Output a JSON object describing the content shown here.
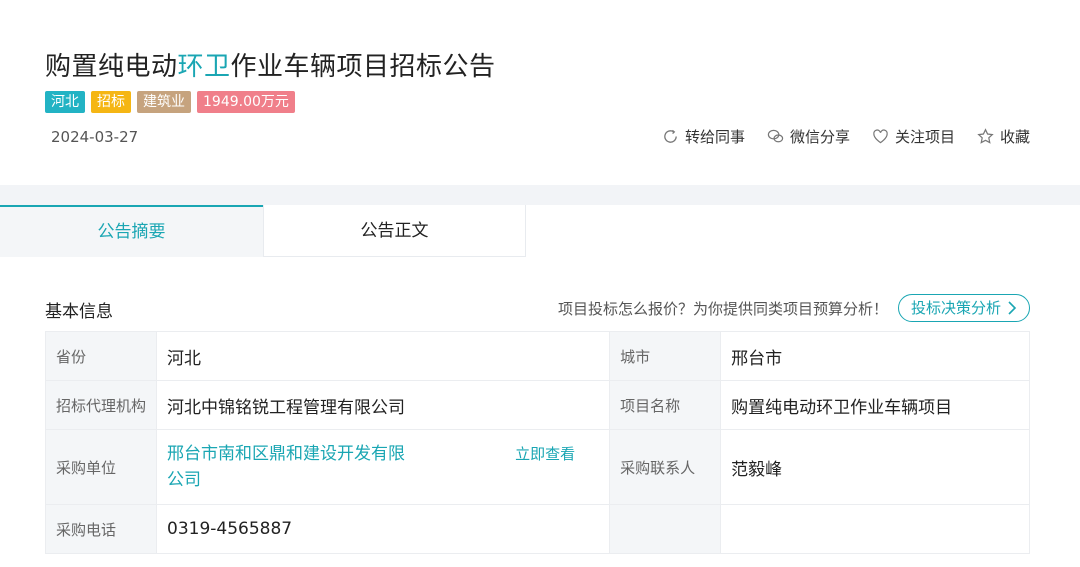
{
  "header": {
    "title_part1": "购置纯电动",
    "title_highlight": "环卫",
    "title_part2": "作业车辆项目招标公告",
    "tags": {
      "region": "河北",
      "type": "招标",
      "industry": "建筑业",
      "budget": "1949.00万元"
    },
    "date": "2024-03-27",
    "actions": {
      "forward": "转给同事",
      "wechat": "微信分享",
      "follow": "关注项目",
      "collect": "收藏"
    }
  },
  "tabs": [
    {
      "label": "公告摘要",
      "active": true
    },
    {
      "label": "公告正文",
      "active": false
    }
  ],
  "basic": {
    "section_title": "基本信息",
    "promo_text": "项目投标怎么报价？为你提供同类项目预算分析！",
    "promo_button": "投标决策分析"
  },
  "info": {
    "province_label": "省份",
    "province": "河北",
    "city_label": "城市",
    "city": "邢台市",
    "agency_label": "招标代理机构",
    "agency": "河北中锦铭锐工程管理有限公司",
    "project_label": "项目名称",
    "project": "购置纯电动环卫作业车辆项目",
    "purchaser_label": "采购单位",
    "purchaser": "邢台市南和区鼎和建设开发有限公司",
    "purchaser_link": "立即查看",
    "contact_label": "采购联系人",
    "contact": "范毅峰",
    "phone_label": "采购电话",
    "phone": "0319-4565887"
  },
  "colors": {
    "accent": "#1aa6b3",
    "tag_region": "#22b3c4",
    "tag_type": "#f5b614",
    "tag_industry": "#c6a37e",
    "tag_budget": "#f07f8a"
  }
}
